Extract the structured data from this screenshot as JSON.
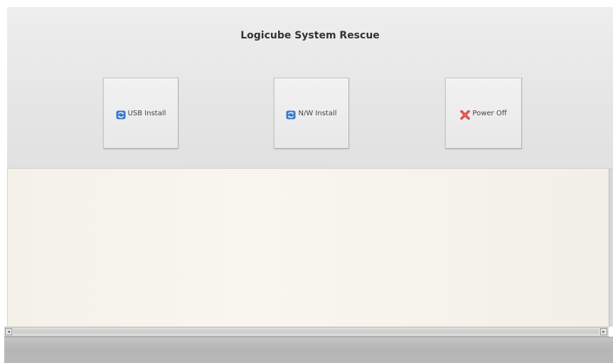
{
  "window": {
    "title": "Logicube System Rescue"
  },
  "buttons": {
    "usb_install": {
      "label": "USB Install",
      "icon": "refresh-icon"
    },
    "nw_install": {
      "label": "N/W Install",
      "icon": "refresh-icon"
    },
    "power_off": {
      "label": "Power Off",
      "icon": "close-x-icon"
    }
  },
  "scrollbar": {
    "left_arrow": "◂",
    "right_arrow": "▸"
  },
  "colors": {
    "refresh_icon": "#3a78c9",
    "power_icon": "#e0403a",
    "log_background": "#f5f3ea"
  }
}
